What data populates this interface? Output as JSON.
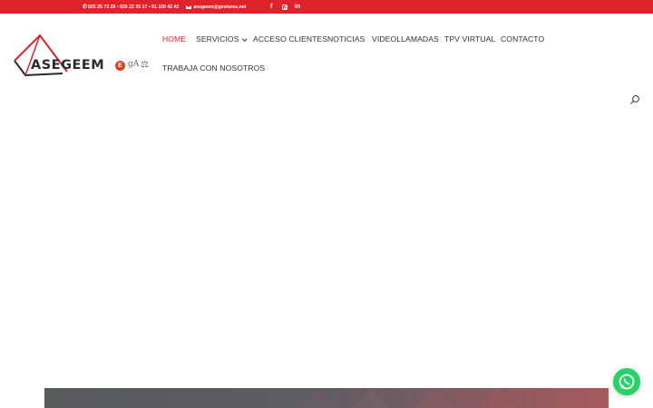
{
  "topbar": {
    "phones": "925 25 73 29 • 925 22 35 17 • 91 109 42 42",
    "email": "asegeem@gestores.net",
    "social": [
      {
        "name": "facebook-icon",
        "glyph": "f"
      },
      {
        "name": "instagram-icon",
        "glyph": ""
      },
      {
        "name": "linkedin-icon",
        "glyph": "in"
      }
    ],
    "background": "#e0232b"
  },
  "logo": {
    "text": "ASEGEEM",
    "accent": "#d9242c"
  },
  "association_badges": {
    "badge1": "E",
    "badge2": "gA",
    "badge3": "⚖"
  },
  "nav": {
    "items": [
      {
        "label": "HOME",
        "active": true
      },
      {
        "label": "SERVICIOS",
        "dropdown": true
      },
      {
        "label": "ACCESO CLIENTES"
      },
      {
        "label": "NOTICIAS"
      },
      {
        "label": "VIDEOLLAMADAS"
      },
      {
        "label": "TPV VIRTUAL"
      },
      {
        "label": "CONTACTO"
      },
      {
        "label": "TRABAJA CON NOSOTROS"
      }
    ],
    "active_color": "#d9242c"
  },
  "search": {
    "icon": "search-icon"
  },
  "whatsapp": {
    "icon": "whatsapp-icon",
    "color": "#25d366"
  }
}
